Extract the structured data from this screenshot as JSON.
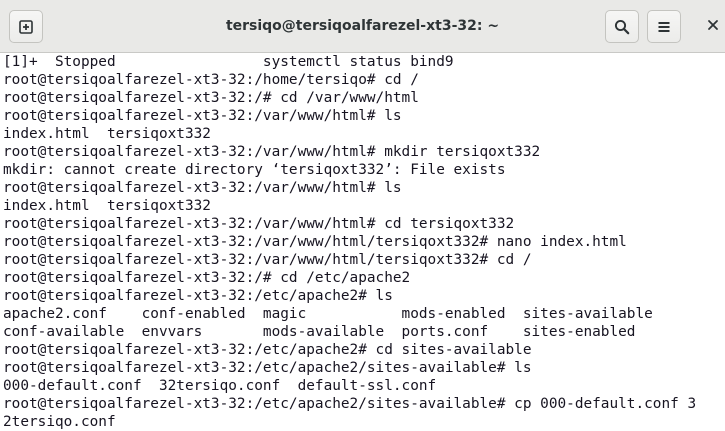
{
  "window": {
    "title": "tersiqo@tersiqoalfarezel-xt3-32: ~"
  },
  "toolbar": {
    "new_tab_icon": "new-tab-icon",
    "search_icon": "search-icon",
    "menu_icon": "hamburger-menu-icon",
    "close_icon": "close-icon"
  },
  "terminal": {
    "lines": [
      "[1]+  Stopped                 systemctl status bind9",
      "root@tersiqoalfarezel-xt3-32:/home/tersiqo# cd /",
      "root@tersiqoalfarezel-xt3-32:/# cd /var/www/html",
      "root@tersiqoalfarezel-xt3-32:/var/www/html# ls",
      "index.html  tersiqoxt332",
      "root@tersiqoalfarezel-xt3-32:/var/www/html# mkdir tersiqoxt332",
      "mkdir: cannot create directory ‘tersiqoxt332’: File exists",
      "root@tersiqoalfarezel-xt3-32:/var/www/html# ls",
      "index.html  tersiqoxt332",
      "root@tersiqoalfarezel-xt3-32:/var/www/html# cd tersiqoxt332",
      "root@tersiqoalfarezel-xt3-32:/var/www/html/tersiqoxt332# nano index.html",
      "root@tersiqoalfarezel-xt3-32:/var/www/html/tersiqoxt332# cd /",
      "root@tersiqoalfarezel-xt3-32:/# cd /etc/apache2",
      "root@tersiqoalfarezel-xt3-32:/etc/apache2# ls",
      "apache2.conf    conf-enabled  magic           mods-enabled  sites-available",
      "conf-available  envvars       mods-available  ports.conf    sites-enabled",
      "root@tersiqoalfarezel-xt3-32:/etc/apache2# cd sites-available",
      "root@tersiqoalfarezel-xt3-32:/etc/apache2/sites-available# ls",
      "000-default.conf  32tersiqo.conf  default-ssl.conf",
      "root@tersiqoalfarezel-xt3-32:/etc/apache2/sites-available# cp 000-default.conf 3",
      "2tersiqo.conf"
    ]
  },
  "colors": {
    "titlebar_bg": "#e9e9e7",
    "terminal_bg": "#ffffff",
    "terminal_fg": "#171421"
  }
}
